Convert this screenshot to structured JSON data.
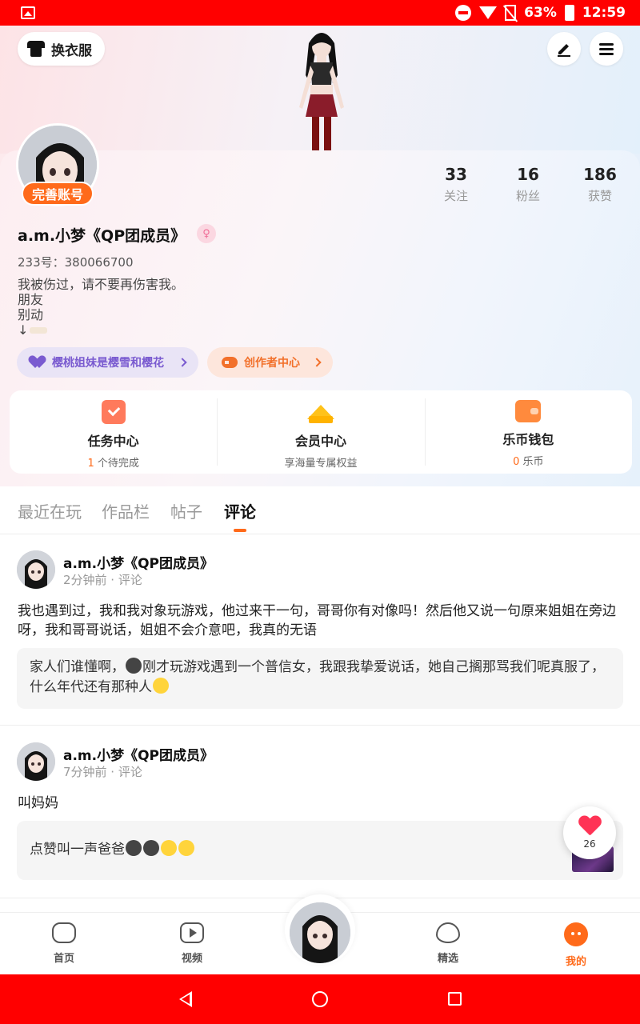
{
  "status_bar": {
    "battery": "63%",
    "time": "12:59"
  },
  "header": {
    "dress_label": "换衣服",
    "edit_icon": "pencil-icon",
    "menu_icon": "hamburger-icon"
  },
  "profile": {
    "complete_badge": "完善账号",
    "stats": [
      {
        "num": "33",
        "label": "关注"
      },
      {
        "num": "16",
        "label": "粉丝"
      },
      {
        "num": "186",
        "label": "获赞"
      }
    ],
    "username": "a.m.小梦《QP团成员》",
    "gender_symbol": "♀",
    "uid": "233号：380066700",
    "bio": [
      "我被伤过，请不要再伤害我。",
      "朋友",
      "别动",
      "↓"
    ],
    "guild_label": "樱桃姐妹是樱雪和樱花",
    "creator_label": "创作者中心"
  },
  "services": [
    {
      "title": "任务中心",
      "highlight": "1",
      "sub": " 个待完成"
    },
    {
      "title": "会员中心",
      "highlight": "",
      "sub": "享海量专属权益"
    },
    {
      "title": "乐币钱包",
      "highlight": "0",
      "sub": " 乐币"
    }
  ],
  "tabs": [
    "最近在玩",
    "作品栏",
    "帖子",
    "评论"
  ],
  "posts": [
    {
      "name": "a.m.小梦《QP团成员》",
      "meta": "2分钟前 · 评论",
      "text": "我也遇到过，我和我对象玩游戏，他过来干一句，哥哥你有对像吗！然后他又说一句原来姐姐在旁边呀，我和哥哥说话，姐姐不会介意吧，我真的无语",
      "quote_a": "家人们谁懂啊，",
      "quote_b": "刚才玩游戏遇到一个普信女，我跟我挚爱说话，她自己搁那骂我们呢真服了，什么年代还有那种人"
    },
    {
      "name": "a.m.小梦《QP团成员》",
      "meta": "7分钟前 · 评论",
      "text": "叫妈妈",
      "quote_a": "点赞叫一声爸爸"
    }
  ],
  "float_like": {
    "count": "26"
  },
  "bottom_nav": [
    "首页",
    "视频",
    "精选",
    "我的"
  ],
  "colors": {
    "accent": "#ff6a1a",
    "status_bar": "#ff0000",
    "guild": "#7a5bd0"
  }
}
